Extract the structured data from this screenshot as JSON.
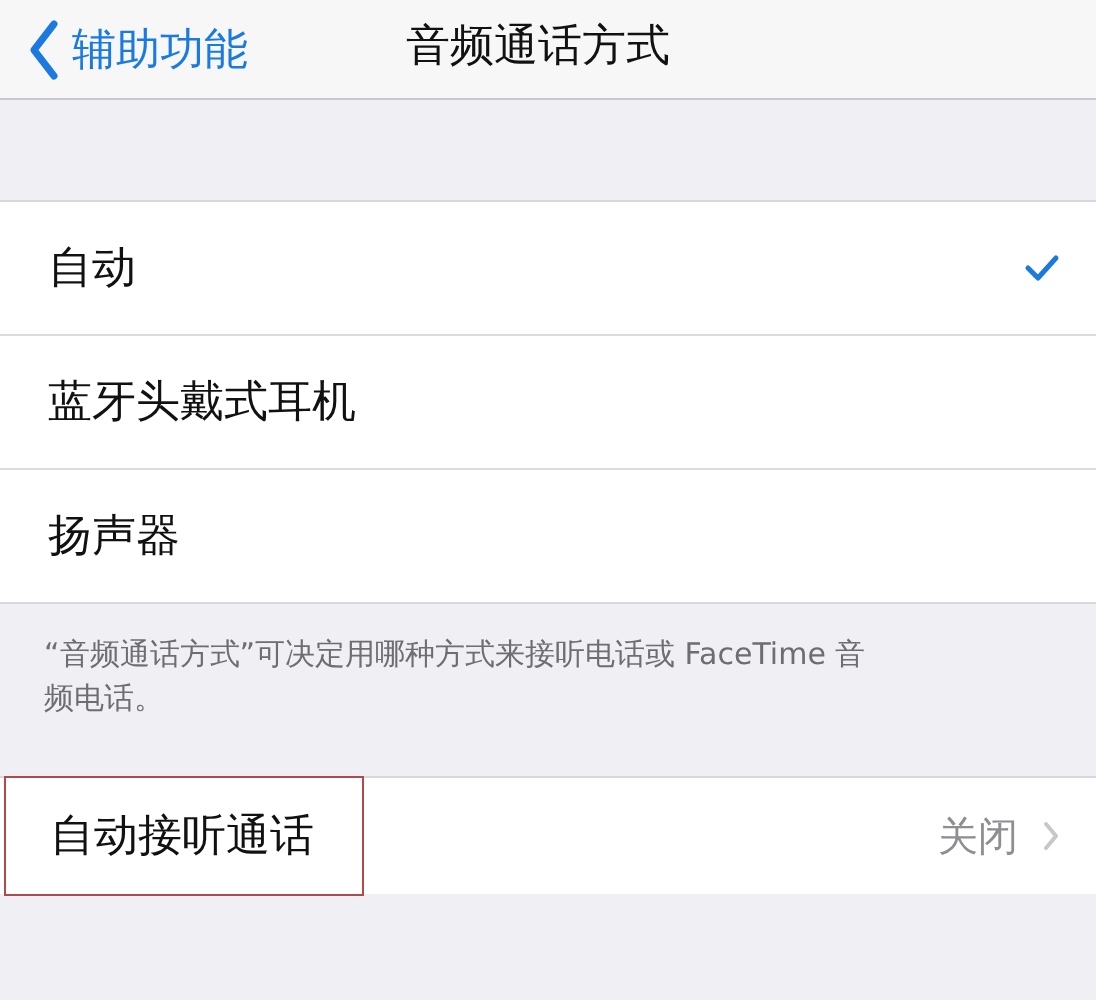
{
  "nav_bar": {
    "back": "辅助功能",
    "title": "音频通话方式"
  },
  "options": [
    {
      "label": "自动",
      "selected": true
    },
    {
      "label": "蓝牙头戴式耳机",
      "selected": false
    },
    {
      "label": "扬声器",
      "selected": false
    }
  ],
  "footer": "“音频通话方式”可决定用哪种方式来接听电话或 FaceTime 音频电话。",
  "auto_answer": {
    "label": "自动接听通话",
    "value": "关闭",
    "highlighted": true
  }
}
